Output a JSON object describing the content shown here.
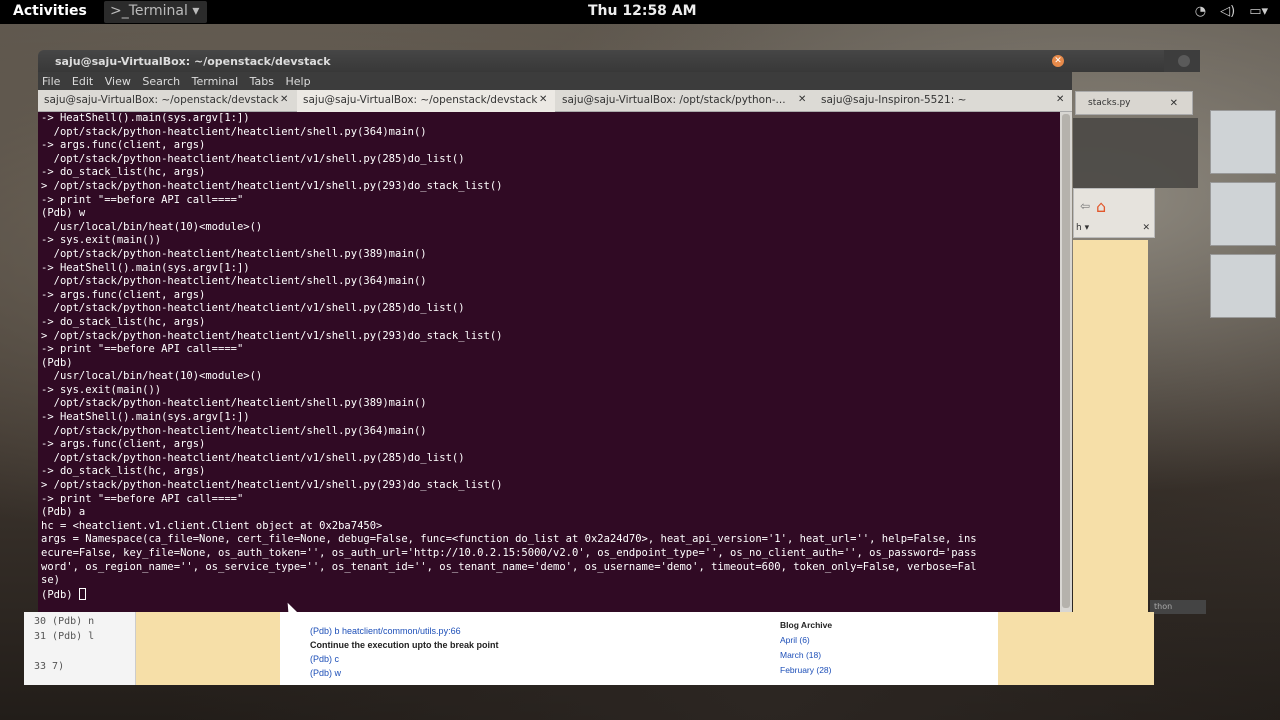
{
  "topbar": {
    "activities": "Activities",
    "app_menu": ">_Terminal ▾",
    "clock": "Thu 12:58 AM",
    "tray": [
      "wifi-icon",
      "volume-icon",
      "battery-icon"
    ]
  },
  "terminal": {
    "title": "saju@saju-VirtualBox: ~/openstack/devstack",
    "menu": [
      "File",
      "Edit",
      "View",
      "Search",
      "Terminal",
      "Tabs",
      "Help"
    ],
    "tabs": [
      {
        "label": "saju@saju-VirtualBox: ~/openstack/devstack",
        "active": false
      },
      {
        "label": "saju@saju-VirtualBox: ~/openstack/devstack",
        "active": true
      },
      {
        "label": "saju@saju-VirtualBox: /opt/stack/python-...",
        "active": false
      },
      {
        "label": "saju@saju-Inspiron-5521: ~",
        "active": false
      }
    ],
    "lines": [
      "-> HeatShell().main(sys.argv[1:])",
      "  /opt/stack/python-heatclient/heatclient/shell.py(364)main()",
      "-> args.func(client, args)",
      "  /opt/stack/python-heatclient/heatclient/v1/shell.py(285)do_list()",
      "-> do_stack_list(hc, args)",
      "> /opt/stack/python-heatclient/heatclient/v1/shell.py(293)do_stack_list()",
      "-> print \"==before API call====\"",
      "(Pdb) w",
      "  /usr/local/bin/heat(10)<module>()",
      "-> sys.exit(main())",
      "  /opt/stack/python-heatclient/heatclient/shell.py(389)main()",
      "-> HeatShell().main(sys.argv[1:])",
      "  /opt/stack/python-heatclient/heatclient/shell.py(364)main()",
      "-> args.func(client, args)",
      "  /opt/stack/python-heatclient/heatclient/v1/shell.py(285)do_list()",
      "-> do_stack_list(hc, args)",
      "> /opt/stack/python-heatclient/heatclient/v1/shell.py(293)do_stack_list()",
      "-> print \"==before API call====\"",
      "(Pdb)",
      "  /usr/local/bin/heat(10)<module>()",
      "-> sys.exit(main())",
      "  /opt/stack/python-heatclient/heatclient/shell.py(389)main()",
      "-> HeatShell().main(sys.argv[1:])",
      "  /opt/stack/python-heatclient/heatclient/shell.py(364)main()",
      "-> args.func(client, args)",
      "  /opt/stack/python-heatclient/heatclient/v1/shell.py(285)do_list()",
      "-> do_stack_list(hc, args)",
      "> /opt/stack/python-heatclient/heatclient/v1/shell.py(293)do_stack_list()",
      "-> print \"==before API call====\"",
      "(Pdb) a",
      "hc = <heatclient.v1.client.Client object at 0x2ba7450>",
      "args = Namespace(ca_file=None, cert_file=None, debug=False, func=<function do_list at 0x2a24d70>, heat_api_version='1', heat_url='', help=False, ins",
      "ecure=False, key_file=None, os_auth_token='', os_auth_url='http://10.0.2.15:5000/v2.0', os_endpoint_type='', os_no_client_auth='', os_password='pass",
      "word', os_region_name='', os_service_type='', os_tenant_id='', os_tenant_name='demo', os_username='demo', timeout=600, token_only=False, verbose=Fal",
      "se)"
    ],
    "prompt": "(Pdb) "
  },
  "background": {
    "editor_tab": "stacks.py",
    "firefox_h": "h ▾",
    "thumb_label": "thon",
    "editor_lines": [
      "30 (Pdb) n",
      "31 (Pdb) l",
      "",
      "33 7)"
    ],
    "blog_lines": [
      {
        "text": "(Pdb) b heatclient/common/utils.py:66",
        "kind": "blue"
      },
      {
        "text": "Continue the execution upto the break point",
        "kind": "bold"
      },
      {
        "text": "(Pdb) c",
        "kind": "blue"
      },
      {
        "text": "(Pdb) w",
        "kind": "blue"
      }
    ],
    "archive_title": "Blog Archive",
    "archive": [
      "April (6)",
      "March (18)",
      "February (28)"
    ]
  },
  "colors": {
    "terminal_bg": "#300a24",
    "terminal_fg": "#ffffff",
    "close_button": "#e78a4a"
  }
}
